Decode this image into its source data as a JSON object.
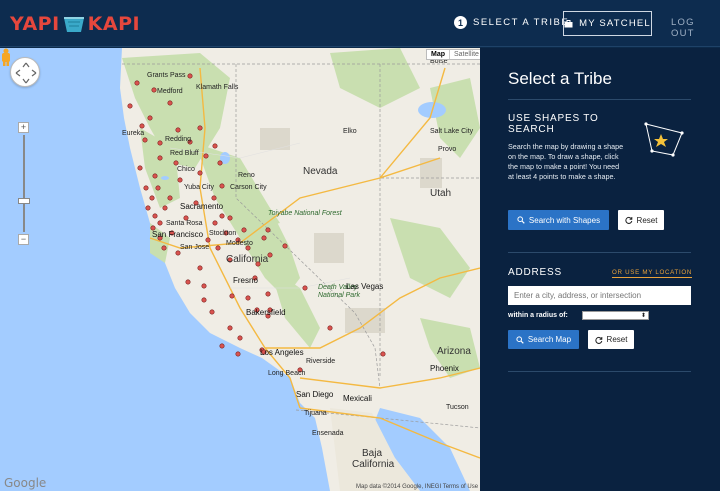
{
  "header": {
    "logo_left": "YAPI",
    "logo_right": "KAPI",
    "step_number": "1",
    "step_label": "SELECT A TRIBE",
    "satchel_label": "MY SATCHEL",
    "logout_label": "LOG OUT"
  },
  "map": {
    "type_map": "Map",
    "type_satellite": "Satellite",
    "google": "Google",
    "attribution": "Map data ©2014 Google, INEGI   Terms of Use",
    "labels": {
      "grants_pass": "Grants Pass",
      "klamath_falls": "Klamath Falls",
      "medford": "Medford",
      "eureka": "Eureka",
      "redding": "Redding",
      "red_bluff": "Red Bluff",
      "chico": "Chico",
      "yuba_city": "Yuba City",
      "santa_rosa": "Santa Rosa",
      "sacramento": "Sacramento",
      "san_francisco": "San Francisco",
      "stockton": "Stockton",
      "modesto": "Modesto",
      "san_jose": "San Jose",
      "california": "California",
      "fresno": "Fresno",
      "bakersfield": "Bakersfield",
      "nevada": "Nevada",
      "reno": "Reno",
      "carson_city": "Carson City",
      "toiyabe": "Toiyabe National Forest",
      "elko": "Elko",
      "salt_lake": "Salt Lake City",
      "utah": "Utah",
      "provo": "Provo",
      "death_valley": "Death Valley National Park",
      "las_vegas": "Las Vegas",
      "los_angeles": "Los Angeles",
      "long_beach": "Long Beach",
      "riverside": "Riverside",
      "san_diego": "San Diego",
      "tijuana": "Tijuana",
      "mexicali": "Mexicali",
      "ensenada": "Ensenada",
      "arizona": "Arizona",
      "phoenix": "Phoenix",
      "tucson": "Tucson",
      "baja": "Baja California",
      "oregon_boise": "Boise"
    }
  },
  "panel": {
    "title": "Select a Tribe",
    "shapes_heading_1": "USE SHAPES TO",
    "shapes_heading_2": "SEARCH",
    "shapes_desc": "Search the map by drawing a shape on the map. To draw a shape, click the map to make a point! You need at least 4 points to make a shape.",
    "search_shapes_label": "Search with Shapes",
    "reset_label": "Reset",
    "address_heading": "ADDRESS",
    "use_location_label": "OR USE MY LOCATION",
    "address_placeholder": "Enter a city, address, or intersection",
    "radius_label": "within a radius of:",
    "search_map_label": "Search Map",
    "reset2_label": "Reset"
  },
  "colors": {
    "header_bg": "#0d2c4f",
    "panel_bg": "#0a2240",
    "accent_blue": "#2b73c6",
    "accent_orange": "#e9a23a",
    "logo_red": "#e5473d",
    "marker": "#d9534f"
  }
}
